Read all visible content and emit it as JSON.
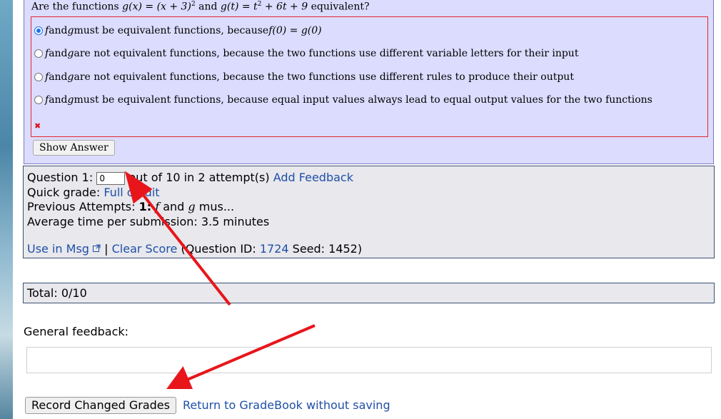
{
  "question": {
    "prefix": "Are the functions ",
    "g_of_x": "g(x) = (x + 3)",
    "sup1": "2",
    "and": " and ",
    "g_of_t": "g(t) = t",
    "sup2": "2",
    "rest": " + 6t + 9",
    "suffix": " equivalent?"
  },
  "choices": [
    {
      "f": "f",
      "mid": " and ",
      "g": "g",
      "text": " must be equivalent functions, because ",
      "math": "f(0) = g(0)",
      "selected": true
    },
    {
      "f": "f",
      "mid": " and ",
      "g": "g",
      "text": " are not equivalent functions, because the two functions use different variable letters for their input",
      "math": "",
      "selected": false
    },
    {
      "f": "f",
      "mid": " and ",
      "g": "g",
      "text": " are not equivalent functions, because the two functions use different rules to produce their output",
      "math": "",
      "selected": false
    },
    {
      "f": "f",
      "mid": " and ",
      "g": "g",
      "text": " must be equivalent functions, because equal input values always lead to equal output values for the two functions",
      "math": "",
      "selected": false
    }
  ],
  "wrong_mark": "✖",
  "show_answer": "Show Answer",
  "grading": {
    "question_label": "Question 1:",
    "score_value": "0",
    "out_of": " out of 10 in 2 attempt(s) ",
    "add_feedback": "Add Feedback",
    "quick_grade_label": "Quick grade: ",
    "full_credit": "Full credit",
    "prev_label": "Previous Attempts: ",
    "prev_num": "1:",
    "prev_f": " f",
    "prev_text": " and ",
    "prev_g": "g",
    "prev_rest": " mus...",
    "avg_time": "Average time per submission: 3.5 minutes",
    "use_in_msg": "Use in Msg",
    "sep": " | ",
    "clear_score": "Clear Score",
    "qid_label": " (Question ID: ",
    "qid": "1724",
    "seed_label": " Seed: ",
    "seed": "1452",
    "close": ")"
  },
  "total": "Total: 0/10",
  "general_feedback_label": "General feedback:",
  "record_button": "Record Changed Grades",
  "return_link": "Return to GradeBook without saving",
  "colors": {
    "annotation_arrow": "#e8151b",
    "link": "#1f4fa8",
    "choice_border": "#e2262f",
    "question_bg": "#dcdcff"
  }
}
